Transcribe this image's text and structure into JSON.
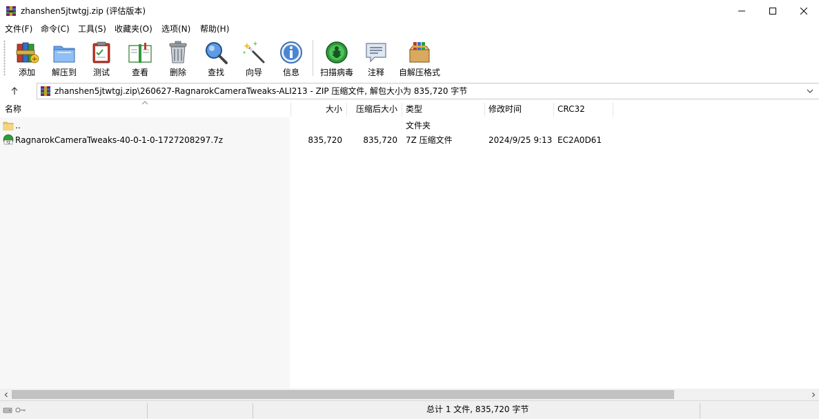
{
  "window": {
    "title": "zhanshen5jtwtgj.zip (评估版本)",
    "icon": "winrar-archive-icon"
  },
  "menu": [
    "文件(F)",
    "命令(C)",
    "工具(S)",
    "收藏夹(O)",
    "选项(N)",
    "帮助(H)"
  ],
  "toolbar": [
    {
      "label": "添加",
      "icon": "add-books-icon"
    },
    {
      "label": "解压到",
      "icon": "extract-folder-icon"
    },
    {
      "label": "测试",
      "icon": "test-clipboard-icon"
    },
    {
      "label": "查看",
      "icon": "view-book-icon"
    },
    {
      "label": "删除",
      "icon": "trash-icon"
    },
    {
      "label": "查找",
      "icon": "magnifier-icon"
    },
    {
      "label": "向导",
      "icon": "wizard-wand-icon"
    },
    {
      "label": "信息",
      "icon": "info-icon"
    },
    {
      "label": "扫描病毒",
      "icon": "virus-scan-icon"
    },
    {
      "label": "注释",
      "icon": "comment-icon"
    },
    {
      "label": "自解压格式",
      "icon": "sfx-box-icon"
    }
  ],
  "address": {
    "path": "zhanshen5jtwtgj.zip\\260627-RagnarokCameraTweaks-ALI213 - ZIP 压缩文件, 解包大小为 835,720 字节"
  },
  "columns": {
    "name": "名称",
    "size": "大小",
    "packed": "压缩后大小",
    "type": "类型",
    "modified": "修改时间",
    "crc": "CRC32"
  },
  "files": [
    {
      "name": "..",
      "size": "",
      "packed": "",
      "type": "文件夹",
      "modified": "",
      "crc": "",
      "icon": "folder-icon"
    },
    {
      "name": "RagnarokCameraTweaks-40-0-1-0-1727208297.7z",
      "size": "835,720",
      "packed": "835,720",
      "type": "7Z 压缩文件",
      "modified": "2024/9/25 9:13",
      "crc": "EC2A0D61",
      "icon": "7z-file-icon"
    }
  ],
  "status": {
    "summary": "总计 1 文件, 835,720 字节"
  },
  "colors": {
    "name_column_bg": "#f7f7f7",
    "statusbar_bg": "#f0f0f0",
    "scroll_thumb": "#c2c2c2"
  }
}
